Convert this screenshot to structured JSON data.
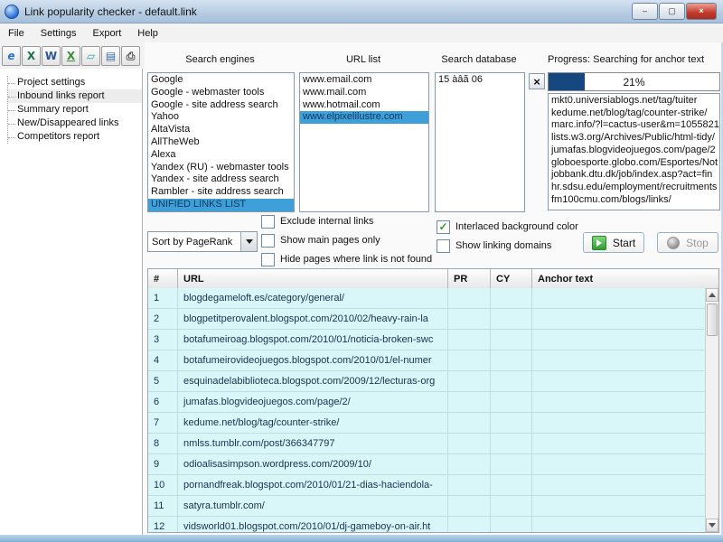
{
  "window": {
    "title": "Link popularity checker - default.link",
    "controls": [
      {
        "glyph": "–"
      },
      {
        "glyph": "▢"
      },
      {
        "glyph": "×"
      }
    ]
  },
  "menu": {
    "items": [
      "File",
      "Settings",
      "Export",
      "Help"
    ]
  },
  "toolbar": {
    "buttons": [
      {
        "name": "export-html-button",
        "icon": "browser-icon",
        "glyph": "e",
        "css": "color:#2a6fd4;font-style:italic;font-weight:bold"
      },
      {
        "name": "export-excel-button",
        "icon": "excel-icon",
        "glyph": "X",
        "css": "color:#1e7145;font-weight:bold"
      },
      {
        "name": "export-word-button",
        "icon": "word-icon",
        "glyph": "W",
        "css": "color:#2b579a;font-weight:bold"
      },
      {
        "name": "export-csv-button",
        "icon": "excel-csv-icon",
        "glyph": "X",
        "css": "color:#3d8a3d;font-weight:bold;text-decoration:underline"
      },
      {
        "name": "open-book-button",
        "icon": "book-icon",
        "glyph": "▱",
        "css": "color:#2aa0b0;font-weight:bold"
      },
      {
        "name": "export-report-button",
        "icon": "report-icon",
        "glyph": "▤",
        "css": "color:#3a6ea5"
      },
      {
        "name": "print-button",
        "icon": "printer-icon",
        "glyph": "⎙",
        "css": "color:#555;font-weight:bold"
      }
    ]
  },
  "sidebar": {
    "items": [
      {
        "name": "sidebar-item-project-settings",
        "label": "Project settings",
        "selected": false
      },
      {
        "name": "sidebar-item-inbound-links-report",
        "label": "Inbound links report",
        "selected": true
      },
      {
        "name": "sidebar-item-summary-report",
        "label": "Summary report",
        "selected": false
      },
      {
        "name": "sidebar-item-new-disappeared-links",
        "label": "New/Disappeared  links",
        "selected": false
      },
      {
        "name": "sidebar-item-competitors-report",
        "label": "Competitors report",
        "selected": false
      }
    ]
  },
  "search_engines": {
    "label": "Search engines",
    "items": [
      {
        "label": "Google",
        "selected": false
      },
      {
        "label": "Google - webmaster tools",
        "selected": false
      },
      {
        "label": "Google - site address search",
        "selected": false
      },
      {
        "label": "Yahoo",
        "selected": false
      },
      {
        "label": "AltaVista",
        "selected": false
      },
      {
        "label": "AllTheWeb",
        "selected": false
      },
      {
        "label": "Alexa",
        "selected": false
      },
      {
        "label": "Yandex (RU) - webmaster tools",
        "selected": false
      },
      {
        "label": "Yandex - site address search",
        "selected": false
      },
      {
        "label": "Rambler - site address search",
        "selected": false
      },
      {
        "label": "UNIFIED LINKS LIST",
        "selected": true
      }
    ]
  },
  "url_list": {
    "label": "URL list",
    "items": [
      {
        "label": "www.email.com",
        "selected": false
      },
      {
        "label": "www.mail.com",
        "selected": false
      },
      {
        "label": "www.hotmail.com",
        "selected": false
      },
      {
        "label": "www.elpixelilustre.com",
        "selected": true
      }
    ]
  },
  "search_database": {
    "label": "Search database",
    "items": [
      {
        "label": "15 àâã 06",
        "selected": false
      }
    ]
  },
  "progress": {
    "label": "Progress: Searching for anchor text",
    "percent_text": "21%",
    "percent_value": 21,
    "urls": [
      "mkt0.universiablogs.net/tag/tuiter",
      "kedume.net/blog/tag/counter-strike/",
      "marc.info/?l=cactus-user&m=1055821",
      "lists.w3.org/Archives/Public/html-tidy/",
      "jumafas.blogvideojuegos.com/page/2",
      "globoesporte.globo.com/Esportes/Not",
      "jobbank.dtu.dk/job/index.asp?act=fin",
      "hr.sdsu.edu/employment/recruitments",
      "fm100cmu.com/blogs/links/"
    ]
  },
  "options": {
    "sort_label": "Sort by PageRank",
    "checkboxes_left": [
      {
        "name": "checkbox-exclude-internal-links",
        "label": "Exclude internal links",
        "checked": false
      },
      {
        "name": "checkbox-show-main-pages-only",
        "label": "Show main pages only",
        "checked": false
      },
      {
        "name": "checkbox-hide-pages-link-not-found",
        "label": "Hide pages where link is not found",
        "checked": false
      }
    ],
    "checkboxes_right": [
      {
        "name": "checkbox-interlaced-background-color",
        "label": "Interlaced background color",
        "checked": true
      },
      {
        "name": "checkbox-show-linking-domains",
        "label": "Show linking domains",
        "checked": false
      }
    ],
    "start_label": "Start",
    "stop_label": "Stop"
  },
  "table": {
    "columns": [
      "#",
      "URL",
      "PR",
      "CY",
      "Anchor text"
    ],
    "rows": [
      {
        "num": "1",
        "url": "blogdegameloft.es/category/general/",
        "pr": "",
        "cy": "",
        "anchor": ""
      },
      {
        "num": "2",
        "url": "blogpetitperovalent.blogspot.com/2010/02/heavy-rain-la",
        "pr": "",
        "cy": "",
        "anchor": ""
      },
      {
        "num": "3",
        "url": "botafumeiroag.blogspot.com/2010/01/noticia-broken-swc",
        "pr": "",
        "cy": "",
        "anchor": ""
      },
      {
        "num": "4",
        "url": "botafumeirovideojuegos.blogspot.com/2010/01/el-numer",
        "pr": "",
        "cy": "",
        "anchor": ""
      },
      {
        "num": "5",
        "url": "esquinadelabiblioteca.blogspot.com/2009/12/lecturas-org",
        "pr": "",
        "cy": "",
        "anchor": ""
      },
      {
        "num": "6",
        "url": "jumafas.blogvideojuegos.com/page/2/",
        "pr": "",
        "cy": "",
        "anchor": ""
      },
      {
        "num": "7",
        "url": "kedume.net/blog/tag/counter-strike/",
        "pr": "",
        "cy": "",
        "anchor": ""
      },
      {
        "num": "8",
        "url": "nmlss.tumblr.com/post/366347797",
        "pr": "",
        "cy": "",
        "anchor": ""
      },
      {
        "num": "9",
        "url": "odioalisasimpson.wordpress.com/2009/10/",
        "pr": "",
        "cy": "",
        "anchor": ""
      },
      {
        "num": "10",
        "url": "pornandfreak.blogspot.com/2010/01/21-dias-haciendola-",
        "pr": "",
        "cy": "",
        "anchor": ""
      },
      {
        "num": "11",
        "url": "satyra.tumblr.com/",
        "pr": "",
        "cy": "",
        "anchor": ""
      },
      {
        "num": "12",
        "url": "vidsworld01.blogspot.com/2010/01/dj-gameboy-on-air.ht",
        "pr": "",
        "cy": "",
        "anchor": ""
      }
    ]
  },
  "colors": {
    "selection_blue": "#3f9fd8",
    "progress_fill": "#17477f",
    "table_row_cyan": "#d9f6f9",
    "close_red": "#c0392b",
    "start_green": "#2f9e2f",
    "titlebar_blue": "#b5cbe2"
  }
}
